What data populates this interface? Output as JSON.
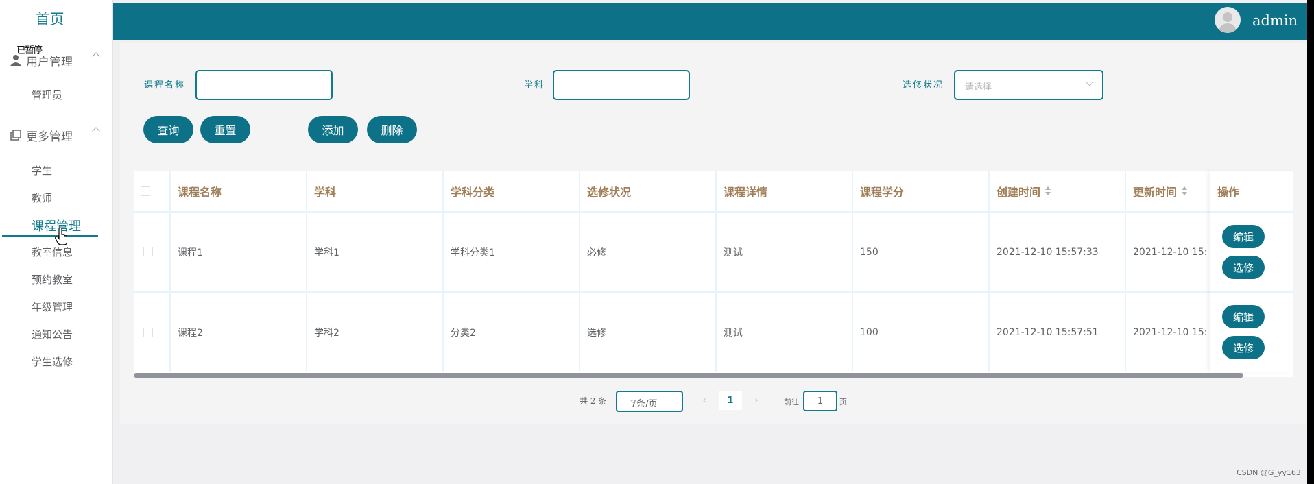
{
  "sidebar": {
    "home": "首页",
    "overlay": "已暂停",
    "groups": [
      {
        "label": "用户管理",
        "items": [
          "管理员"
        ]
      },
      {
        "label": "更多管理",
        "items": [
          "学生",
          "教师",
          "课程管理",
          "教室信息",
          "预约教室",
          "年级管理",
          "通知公告",
          "学生选修"
        ]
      }
    ],
    "active_item": "课程管理"
  },
  "header": {
    "username": "admin"
  },
  "filters": {
    "course_name_label": "课程名称",
    "subject_label": "学科",
    "elective_label": "选修状况",
    "elective_placeholder": "请选择",
    "course_name_value": "",
    "subject_value": ""
  },
  "toolbar": {
    "query": "查询",
    "reset": "重置",
    "add": "添加",
    "delete": "删除"
  },
  "table": {
    "columns": [
      "课程名称",
      "学科",
      "学科分类",
      "选修状况",
      "课程详情",
      "课程学分",
      "创建时间",
      "更新时间",
      "操作"
    ],
    "rows": [
      {
        "name": "课程1",
        "subject": "学科1",
        "category": "学科分类1",
        "status": "必修",
        "detail": "测试",
        "credit": "150",
        "created": "2021-12-10 15:57:33",
        "updated": "2021-12-10 15:"
      },
      {
        "name": "课程2",
        "subject": "学科2",
        "category": "分类2",
        "status": "选修",
        "detail": "测试",
        "credit": "100",
        "created": "2021-12-10 15:57:51",
        "updated": "2021-12-10 15:"
      }
    ],
    "actions": {
      "edit": "编辑",
      "elect": "选修"
    }
  },
  "pagination": {
    "total": "共 2 条",
    "page_size": "7条/页",
    "prev": "‹",
    "current": "1",
    "next": "›",
    "goto_prefix": "前往",
    "goto_value": "1",
    "goto_suffix": "页"
  },
  "watermark": "CSDN @G_yy163",
  "colors": {
    "accent": "#0d7287",
    "header_text": "#a07e57"
  }
}
